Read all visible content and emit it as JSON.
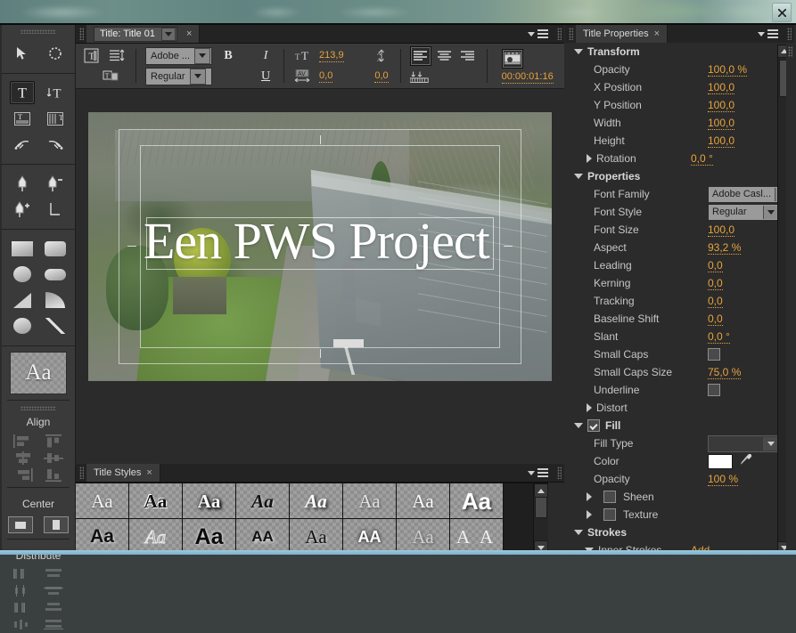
{
  "window": {
    "close_label": "×"
  },
  "tools": {
    "groups": [
      {
        "name": "selection",
        "items": [
          {
            "icon": "selection-arrow-icon",
            "label": "Selection Tool",
            "selected": false
          },
          {
            "icon": "rotation-icon",
            "label": "Rotation Tool",
            "selected": false
          }
        ]
      },
      {
        "name": "type",
        "items": [
          {
            "icon": "type-tool-icon",
            "label": "Type Tool",
            "selected": true
          },
          {
            "icon": "vertical-type-tool-icon",
            "label": "Vertical Type Tool",
            "selected": false
          },
          {
            "icon": "area-type-tool-icon",
            "label": "Area Type Tool",
            "selected": false
          },
          {
            "icon": "vertical-area-type-tool-icon",
            "label": "Vertical Area Type Tool",
            "selected": false
          },
          {
            "icon": "path-type-tool-icon",
            "label": "Path Type Tool",
            "selected": false
          },
          {
            "icon": "vertical-path-type-tool-icon",
            "label": "Vertical Path Type Tool",
            "selected": false
          }
        ]
      },
      {
        "name": "pen",
        "items": [
          {
            "icon": "pen-tool-icon",
            "label": "Pen Tool",
            "selected": false
          },
          {
            "icon": "delete-anchor-point-icon",
            "label": "Delete Anchor Point Tool",
            "selected": false
          },
          {
            "icon": "add-anchor-point-icon",
            "label": "Add Anchor Point Tool",
            "selected": false
          },
          {
            "icon": "convert-anchor-point-icon",
            "label": "Convert Anchor Point Tool",
            "selected": false
          }
        ]
      },
      {
        "name": "shapes",
        "items": [
          {
            "icon": "rectangle-tool-icon",
            "label": "Rectangle Tool",
            "selected": false
          },
          {
            "icon": "rounded-corner-rectangle-tool-icon",
            "label": "Rounded Corner Rectangle Tool",
            "selected": false
          },
          {
            "icon": "clipped-corner-rectangle-tool-icon",
            "label": "Clipped Corner Rectangle Tool",
            "selected": false
          },
          {
            "icon": "rounded-rectangle-tool-icon",
            "label": "Rounded Rectangle Tool",
            "selected": false
          },
          {
            "icon": "wedge-tool-icon",
            "label": "Wedge Tool",
            "selected": false
          },
          {
            "icon": "arc-tool-icon",
            "label": "Arc Tool",
            "selected": false
          },
          {
            "icon": "ellipse-tool-icon",
            "label": "Ellipse Tool",
            "selected": false
          },
          {
            "icon": "line-tool-icon",
            "label": "Line Tool",
            "selected": false
          }
        ]
      }
    ],
    "sample_text": "Aa",
    "align": {
      "title": "Align",
      "buttons": [
        "align-left-icon",
        "align-top-icon",
        "align-horizontal-center-icon",
        "align-vertical-center-icon",
        "align-right-icon",
        "align-bottom-icon"
      ]
    },
    "center": {
      "title": "Center",
      "buttons": [
        "center-horizontally-icon",
        "center-vertically-icon"
      ]
    },
    "distribute": {
      "title": "Distribute",
      "buttons": [
        "distribute-left-icon",
        "distribute-top-icon",
        "distribute-center-vertically-icon",
        "distribute-center-horizontally-icon",
        "distribute-right-icon",
        "distribute-bottom-icon",
        "distribute-even-spacing-vertical-icon",
        "distribute-even-spacing-horizontal-icon"
      ]
    }
  },
  "title_panel": {
    "tab_label": "Title: Title 01",
    "close_label": "×",
    "toolbar": {
      "font_family": "Adobe ...",
      "font_style": "Regular",
      "bold_label": "B",
      "italic_label": "I",
      "underline_label": "U",
      "font_size": "213,9",
      "kerning": "0,0",
      "leading": "0,0",
      "timecode": "00:00:01:16",
      "icons": [
        "title-templates-icon",
        "roll-crawl-options-icon",
        "tab-stops-icon",
        "font-size-icon",
        "kerning-icon",
        "leading-icon",
        "align-left-icon",
        "align-center-icon",
        "align-right-icon",
        "tab-stops-icon",
        "show-background-video-icon"
      ]
    },
    "preview": {
      "text": "Een PWS Project"
    }
  },
  "styles_panel": {
    "tab_label": "Title Styles",
    "close_label": "×",
    "swatches": [
      {
        "label": "Aa",
        "style": "caslon-white"
      },
      {
        "label": "Aa",
        "style": "caslon-black-outline"
      },
      {
        "label": "Aa",
        "style": "caslon-white-shadow"
      },
      {
        "label": "Aa",
        "style": "script-black"
      },
      {
        "label": "Aa",
        "style": "script-white"
      },
      {
        "label": "Aa",
        "style": "serif-gray"
      },
      {
        "label": "Aa",
        "style": "serif-white"
      },
      {
        "label": "Aa",
        "style": "heavy-white"
      },
      {
        "label": "Aa",
        "style": "bold-white"
      },
      {
        "label": "Aa",
        "style": "outline-script"
      },
      {
        "label": "Aa",
        "style": "rounded-black"
      },
      {
        "label": "AA",
        "style": "caps-black"
      },
      {
        "label": "Aa",
        "style": "serif-black"
      },
      {
        "label": "AA",
        "style": "caps-white-glow"
      },
      {
        "label": "Aa",
        "style": "serif-gray-soft"
      },
      {
        "label": "A A",
        "style": "thin-white"
      }
    ]
  },
  "properties_panel": {
    "tab_label": "Title Properties",
    "close_label": "×",
    "sections": [
      {
        "name": "Transform",
        "expanded": true,
        "rows": [
          {
            "label": "Opacity",
            "value": "100,0 %",
            "type": "number"
          },
          {
            "label": "X Position",
            "value": "100,0",
            "type": "number"
          },
          {
            "label": "Y Position",
            "value": "100,0",
            "type": "number"
          },
          {
            "label": "Width",
            "value": "100,0",
            "type": "number"
          },
          {
            "label": "Height",
            "value": "100,0",
            "type": "number"
          },
          {
            "label": "Rotation",
            "value": "0,0 °",
            "type": "number",
            "disclosure": "collapsed"
          }
        ]
      },
      {
        "name": "Properties",
        "expanded": true,
        "rows": [
          {
            "label": "Font Family",
            "value": "Adobe Casl...",
            "type": "select"
          },
          {
            "label": "Font Style",
            "value": "Regular",
            "type": "select"
          },
          {
            "label": "Font Size",
            "value": "100,0",
            "type": "number"
          },
          {
            "label": "Aspect",
            "value": "93,2 %",
            "type": "number"
          },
          {
            "label": "Leading",
            "value": "0,0",
            "type": "number"
          },
          {
            "label": "Kerning",
            "value": "0,0",
            "type": "number"
          },
          {
            "label": "Tracking",
            "value": "0,0",
            "type": "number"
          },
          {
            "label": "Baseline Shift",
            "value": "0,0",
            "type": "number"
          },
          {
            "label": "Slant",
            "value": "0,0 °",
            "type": "number"
          },
          {
            "label": "Small Caps",
            "value": "",
            "type": "checkbox",
            "checked": false
          },
          {
            "label": "Small Caps Size",
            "value": "75,0 %",
            "type": "number"
          },
          {
            "label": "Underline",
            "value": "",
            "type": "checkbox",
            "checked": false
          },
          {
            "label": "Distort",
            "value": "",
            "type": "group",
            "disclosure": "collapsed"
          }
        ]
      },
      {
        "name": "Fill",
        "expanded": true,
        "checked": true,
        "rows": [
          {
            "label": "Fill Type",
            "value": "",
            "type": "select"
          },
          {
            "label": "Color",
            "value": "#ffffff",
            "type": "color"
          },
          {
            "label": "Opacity",
            "value": "100 %",
            "type": "number"
          },
          {
            "label": "Sheen",
            "value": "",
            "type": "checkbox-group",
            "checked": false,
            "disclosure": "collapsed"
          },
          {
            "label": "Texture",
            "value": "",
            "type": "checkbox-group",
            "checked": false,
            "disclosure": "collapsed"
          }
        ]
      },
      {
        "name": "Strokes",
        "expanded": true,
        "rows": [
          {
            "label": "Inner Strokes",
            "value": "Add",
            "type": "action",
            "disclosure": "expanded"
          }
        ]
      }
    ]
  },
  "colors": {
    "accent_value": "#e8a33d",
    "panel_bg": "#2b2b2b",
    "toolbar_bg": "#3a3a3a",
    "fill_color": "#ffffff"
  }
}
